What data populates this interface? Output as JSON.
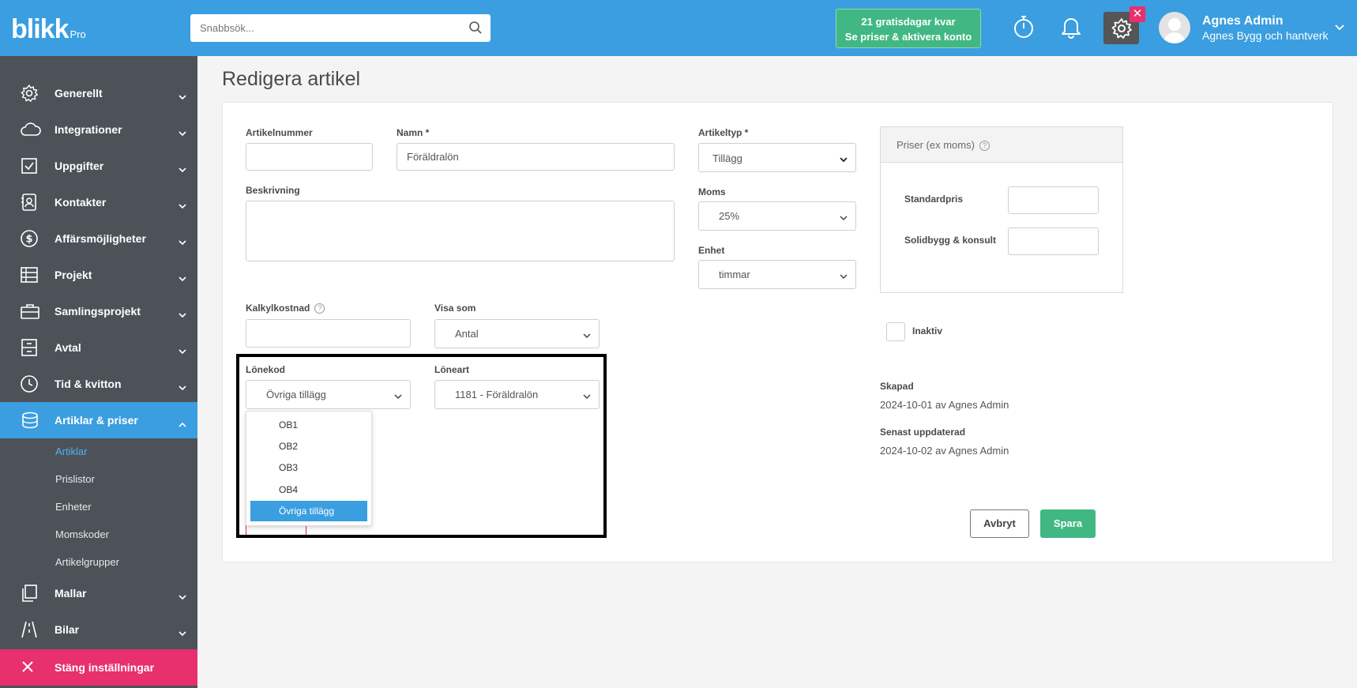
{
  "app": {
    "logo": "blikk",
    "logo_suffix": "Pro",
    "search_placeholder": "Snabbsök...",
    "trial_line1": "21 gratisdagar kvar",
    "trial_line2": "Se priser & aktivera konto",
    "user_name": "Agnes Admin",
    "user_company": "Agnes Bygg och hantverk"
  },
  "sidebar": {
    "items": [
      {
        "label": "Generellt",
        "icon": "gear-icon"
      },
      {
        "label": "Integrationer",
        "icon": "cloud-icon"
      },
      {
        "label": "Uppgifter",
        "icon": "checkbox-icon"
      },
      {
        "label": "Kontakter",
        "icon": "contact-icon"
      },
      {
        "label": "Affärsmöjligheter",
        "icon": "dollar-icon"
      },
      {
        "label": "Projekt",
        "icon": "table-icon"
      },
      {
        "label": "Samlingsprojekt",
        "icon": "briefcase-icon"
      },
      {
        "label": "Avtal",
        "icon": "cabinet-icon"
      },
      {
        "label": "Tid & kvitton",
        "icon": "clock-icon"
      },
      {
        "label": "Artiklar & priser",
        "icon": "coins-icon"
      },
      {
        "label": "Mallar",
        "icon": "copy-icon"
      },
      {
        "label": "Bilar",
        "icon": "road-icon"
      }
    ],
    "sub_items": [
      "Artiklar",
      "Prislistor",
      "Enheter",
      "Momskoder",
      "Artikelgrupper"
    ],
    "close_label": "Stäng inställningar"
  },
  "page": {
    "title": "Redigera artikel"
  },
  "form": {
    "artikelnummer_label": "Artikelnummer",
    "artikelnummer_value": "",
    "namn_label": "Namn *",
    "namn_value": "Föräldralön",
    "beskrivning_label": "Beskrivning",
    "beskrivning_value": "",
    "artikeltyp_label": "Artikeltyp *",
    "artikeltyp_value": "Tillägg",
    "moms_label": "Moms",
    "moms_value": "25%",
    "enhet_label": "Enhet",
    "enhet_value": "timmar",
    "kalkylkostnad_label": "Kalkylkostnad",
    "kalkylkostnad_value": "",
    "visa_som_label": "Visa som",
    "visa_som_value": "Antal",
    "lonekod_label": "Lönekod",
    "lonekod_value": "Övriga tillägg",
    "loneart_label": "Löneart",
    "loneart_value": "1181 - Föräldralön",
    "lonekod_options": [
      "OB1",
      "OB2",
      "OB3",
      "OB4",
      "Övriga tillägg"
    ],
    "lonekod_selected_index": 4
  },
  "prices": {
    "header": "Priser (ex moms)",
    "rows": [
      {
        "label": "Standardpris",
        "value": ""
      },
      {
        "label": "Solidbygg & konsult",
        "value": ""
      }
    ]
  },
  "status": {
    "inaktiv_label": "Inaktiv",
    "inaktiv_checked": false,
    "skapad_label": "Skapad",
    "skapad_value": "2024-10-01 av Agnes Admin",
    "uppdaterad_label": "Senast uppdaterad",
    "uppdaterad_value": "2024-10-02 av Agnes Admin"
  },
  "actions": {
    "cancel": "Avbryt",
    "save": "Spara"
  },
  "colors": {
    "header_blue": "#3a9ee0",
    "sidebar": "#4d5259",
    "accent_green": "#41b883",
    "close_pink": "#e8306e"
  }
}
